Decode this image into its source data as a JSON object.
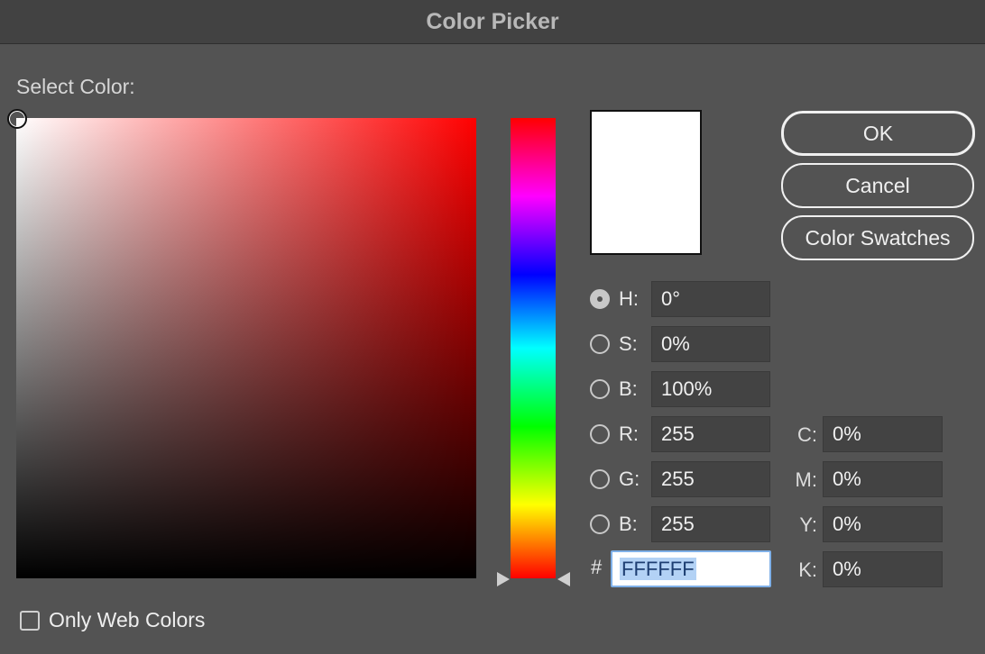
{
  "window": {
    "title": "Color Picker"
  },
  "select_label": "Select Color:",
  "buttons": {
    "ok": "OK",
    "cancel": "Cancel",
    "swatches": "Color Swatches"
  },
  "hsb": [
    {
      "label": "H:",
      "value": "0°",
      "selected": true
    },
    {
      "label": "S:",
      "value": "0%",
      "selected": false
    },
    {
      "label": "B:",
      "value": "100%",
      "selected": false
    }
  ],
  "rgb": [
    {
      "label": "R:",
      "value": "255",
      "selected": false
    },
    {
      "label": "G:",
      "value": "255",
      "selected": false
    },
    {
      "label": "B:",
      "value": "255",
      "selected": false
    }
  ],
  "hex": {
    "prefix": "#",
    "value": "FFFFFF"
  },
  "cmyk": [
    {
      "label": "C:",
      "value": "0%"
    },
    {
      "label": "M:",
      "value": "0%"
    },
    {
      "label": "Y:",
      "value": "0%"
    },
    {
      "label": "K:",
      "value": "0%"
    }
  ],
  "only_web_colors": {
    "label": "Only Web Colors",
    "checked": false
  },
  "colors": {
    "current": "#FFFFFF",
    "hue": "#FF0000"
  }
}
